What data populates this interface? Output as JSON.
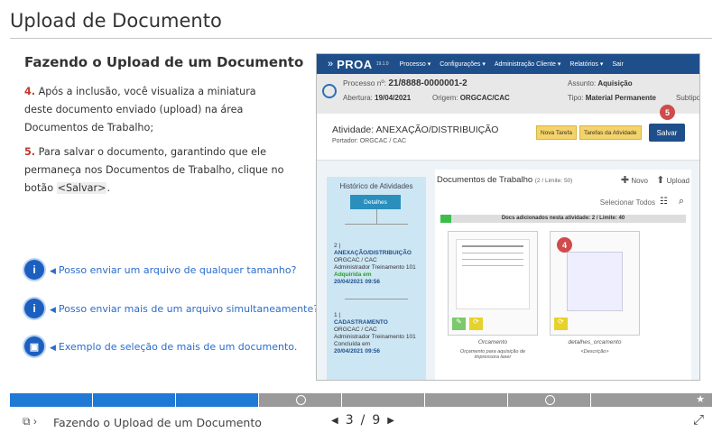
{
  "page_title": "Upload de Documento",
  "section_heading": "Fazendo o Upload de um Documento",
  "step4": {
    "num": "4.",
    "text": " Após a inclusão, você visualiza a miniatura deste documento enviado (upload) na área Documentos de Trabalho;"
  },
  "step5": {
    "num": "5.",
    "text_before": " Para salvar o documento, garantindo que ele permaneça nos Documentos de Trabalho, clique no botão ",
    "code": "<Salvar>",
    "text_after": "."
  },
  "links": [
    {
      "icon": "info-icon",
      "glyph": "i",
      "text": "Posso enviar um arquivo de qualquer tamanho?"
    },
    {
      "icon": "info-icon",
      "glyph": "i",
      "text": "Posso enviar mais de um arquivo simultaneamente?"
    },
    {
      "icon": "image-icon",
      "glyph": "▣",
      "text": "Exemplo de seleção de mais de um documento."
    }
  ],
  "shot": {
    "logo": "PROA",
    "version": "19.1.0",
    "menus": [
      "Processo ▾",
      "Configurações ▾",
      "Administração Cliente ▾",
      "Relatórios ▾",
      "Sair"
    ],
    "processo_label": "Processo nº:",
    "processo_value": "21/8888-0000001-2",
    "assunto_label": "Assunto:",
    "assunto_value": "Aquisição",
    "abertura_label": "Abertura:",
    "abertura_value": "19/04/2021",
    "origem_label": "Origem:",
    "origem_value": "ORGCAC/CAC",
    "tipo_label": "Tipo:",
    "tipo_value": "Material Permanente",
    "subtipo_label": "Subtipo",
    "activity_label": "Atividade:",
    "activity_value": "ANEXAÇÃO/DISTRIBUIÇÃO",
    "portador": "Portador: ORGCAC / CAC",
    "nova_tarefa": "Nova Tarefa",
    "tarefas_atividade": "Tarefas da Atividade",
    "salvar": "Salvar",
    "badge5": "5",
    "badge4": "4",
    "hist_title": "Histórico de Atividades",
    "detalhes": "Detalhes",
    "entry1": {
      "n": "2 |",
      "name": "ANEXAÇÃO/DISTRIBUIÇÃO",
      "org": "ORGCAC / CAC",
      "user": "Administrador Treinamento 101",
      "status": "Adquirida em",
      "date": "20/04/2021 09:56"
    },
    "entry2": {
      "n": "1 |",
      "name": "CADASTRAMENTO",
      "org": "ORGCAC / CAC",
      "user": "Administrador Treinamento 101",
      "status": "Concluída em",
      "date": "20/04/2021 09:56"
    },
    "docs_title": "Documentos de Trabalho",
    "docs_limit": "(2 / Limite: 50)",
    "novo": "Novo",
    "upload": "Upload",
    "selecionar_todos": "Selecionar Todos",
    "docs_strip": "Docs adicionados nesta atividade: 2 / Limite: 40",
    "doc1_name": "Orcamento",
    "doc1_desc": "Orçamento para aquisição de impressora laser",
    "doc2_name": "detalhes_orcamento",
    "doc2_desc": "<Descrição>"
  },
  "player": {
    "progress_done_fraction": 0.333,
    "label": "Fazendo o Upload de um Documento",
    "current_page": "3",
    "separator": "/",
    "total_pages": "9"
  }
}
